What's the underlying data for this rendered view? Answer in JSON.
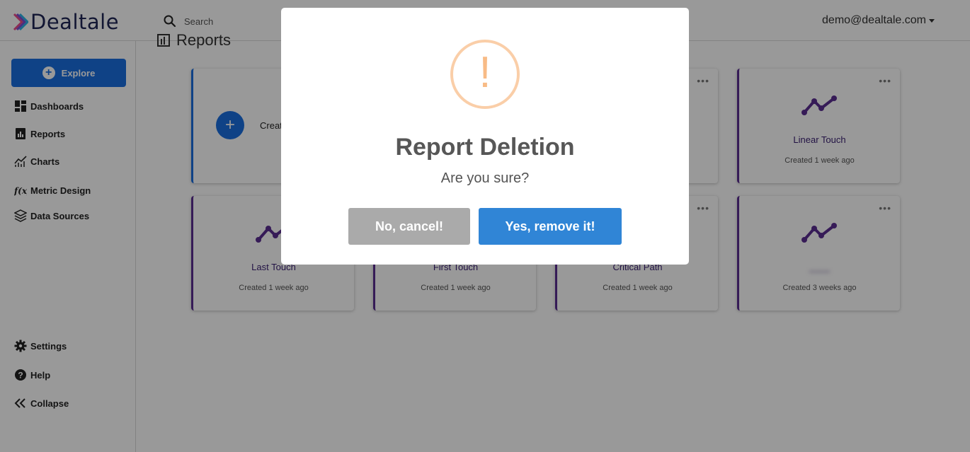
{
  "app": {
    "logo_text": "Dealtale",
    "search_placeholder": "Search",
    "user_email": "demo@dealtale.com"
  },
  "sidebar": {
    "explore_label": "Explore",
    "items": [
      {
        "label": "Dashboards",
        "icon": "dashboard-icon"
      },
      {
        "label": "Reports",
        "icon": "report-icon"
      },
      {
        "label": "Charts",
        "icon": "chart-icon"
      },
      {
        "label": "Metric Design",
        "icon": "function-icon"
      },
      {
        "label": "Data Sources",
        "icon": "layers-icon"
      }
    ],
    "bottom_items": [
      {
        "label": "Settings",
        "icon": "gear-icon"
      },
      {
        "label": "Help",
        "icon": "help-icon"
      },
      {
        "label": "Collapse",
        "icon": "double-chevron-left-icon"
      }
    ]
  },
  "page": {
    "title": "Reports",
    "create_label": "Creat",
    "cards": [
      {
        "name": "Linear Touch",
        "date": "Created 1 week ago"
      },
      {
        "name": "Last Touch",
        "date": "Created 1 week ago"
      },
      {
        "name": "First Touch",
        "date": "Created 1 week ago"
      },
      {
        "name": "Critical Path",
        "date": "Created 1 week ago"
      },
      {
        "name": "____",
        "date": "Created 3 weeks ago"
      }
    ]
  },
  "modal": {
    "icon": "!",
    "title": "Report Deletion",
    "text": "Are you sure?",
    "cancel_label": "No, cancel!",
    "confirm_label": "Yes, remove it!"
  },
  "colors": {
    "primary": "#1a6fe0",
    "brand_purple": "#5a2d91",
    "confirm": "#3085d6",
    "cancel": "#aaaaaa",
    "warning": "#f8bb86"
  }
}
